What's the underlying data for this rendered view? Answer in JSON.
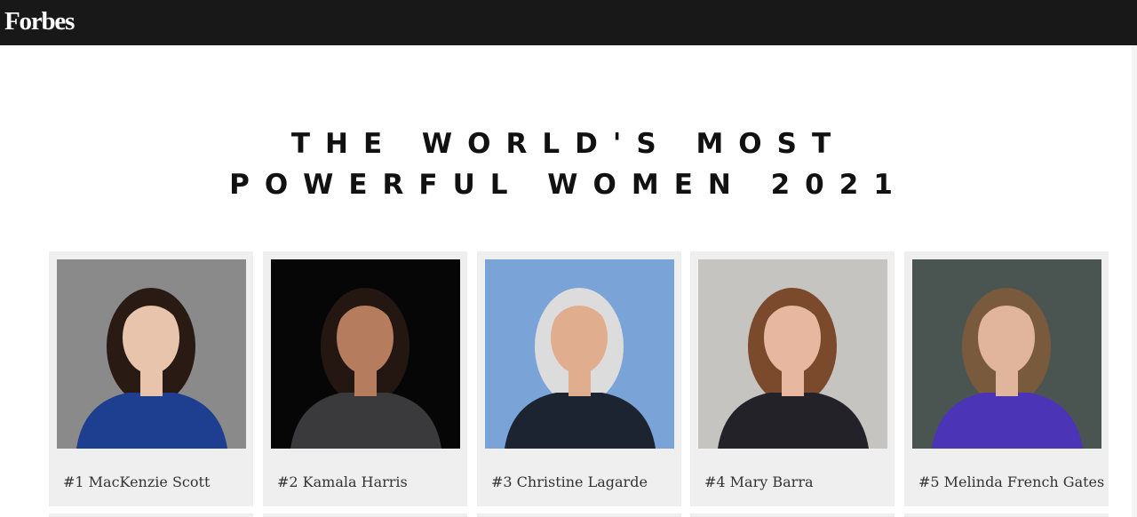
{
  "header": {
    "logo": "Forbes"
  },
  "page": {
    "title_line1": "THE WORLD'S MOST",
    "title_line2": "POWERFUL WOMEN 2021"
  },
  "list": [
    {
      "name": "#1 MacKenzie Scott",
      "photo": "portrait-mackenzie-scott",
      "bg": "#8a8a8a",
      "hair": "#2a1a14",
      "outfit": "#1e3f8f",
      "skin": "#e9c4ad"
    },
    {
      "name": "#2 Kamala Harris",
      "photo": "portrait-kamala-harris",
      "bg": "#060606",
      "hair": "#241712",
      "outfit": "#3a3a3c",
      "skin": "#b57d5d"
    },
    {
      "name": "#3 Christine Lagarde",
      "photo": "portrait-christine-lagarde",
      "bg": "#7aa3d8",
      "hair": "#dcdcdc",
      "outfit": "#1d2431",
      "skin": "#e1ad8f"
    },
    {
      "name": "#4 Mary Barra",
      "photo": "portrait-mary-barra",
      "bg": "#c6c4c0",
      "hair": "#7b4a2c",
      "outfit": "#222228",
      "skin": "#e7b79f"
    },
    {
      "name": "#5 Melinda French Gates",
      "photo": "portrait-melinda-french-gates",
      "bg": "#4a5552",
      "hair": "#7a5a3c",
      "outfit": "#4b34b5",
      "skin": "#e0b59c"
    }
  ]
}
